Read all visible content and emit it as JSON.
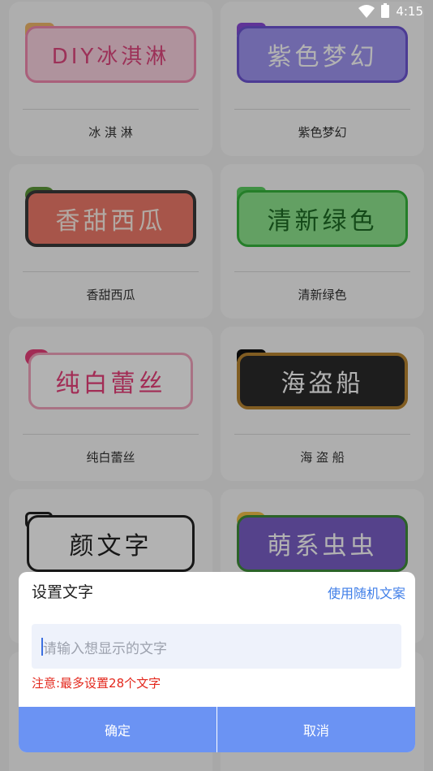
{
  "status": {
    "time": "4:15"
  },
  "styles": [
    {
      "label": "冰 淇 淋",
      "badge_text": "DIY冰淇淋"
    },
    {
      "label": "紫色梦幻",
      "badge_text": "紫色梦幻"
    },
    {
      "label": "香甜西瓜",
      "badge_text": "香甜西瓜"
    },
    {
      "label": "清新绿色",
      "badge_text": "清新绿色"
    },
    {
      "label": "纯白蕾丝",
      "badge_text": "纯白蕾丝"
    },
    {
      "label": "海 盗 船",
      "badge_text": "海盗船"
    },
    {
      "label": "",
      "badge_text": "颜文字"
    },
    {
      "label": "",
      "badge_text": "萌系虫虫"
    }
  ],
  "dialog": {
    "title": "设置文字",
    "random_link": "使用随机文案",
    "input_placeholder": "请输入想显示的文字",
    "input_value": "",
    "notice": "注意:最多设置28个文字",
    "confirm": "确定",
    "cancel": "取消"
  },
  "colors": {
    "link": "#3f7ee8",
    "notice": "#e3271c",
    "button_bar": "#6b93f3"
  }
}
